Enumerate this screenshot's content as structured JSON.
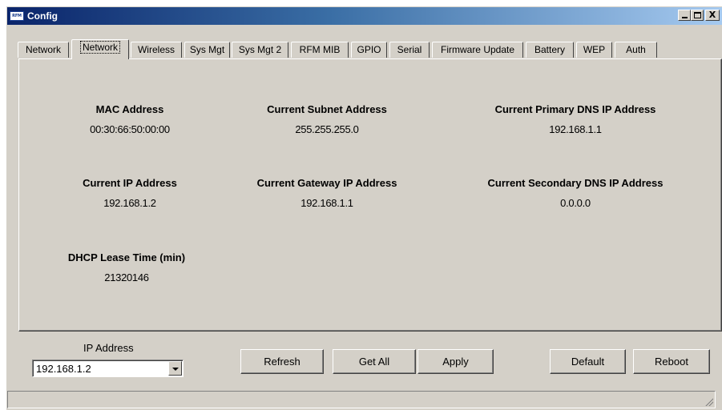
{
  "window": {
    "title": "Config",
    "icon_text": "RFM",
    "close_glyph": "X"
  },
  "tabs": [
    {
      "label": "Network",
      "active": false
    },
    {
      "label": "Network",
      "active": true
    },
    {
      "label": "Wireless",
      "active": false
    },
    {
      "label": "Sys Mgt",
      "active": false
    },
    {
      "label": "Sys Mgt 2",
      "active": false
    },
    {
      "label": "RFM MIB",
      "active": false
    },
    {
      "label": "GPIO",
      "active": false
    },
    {
      "label": "Serial",
      "active": false
    },
    {
      "label": "Firmware Update",
      "active": false
    },
    {
      "label": "Battery",
      "active": false
    },
    {
      "label": "WEP",
      "active": false
    },
    {
      "label": "Auth",
      "active": false
    }
  ],
  "fields": {
    "mac": {
      "label": "MAC Address",
      "value": "00:30:66:50:00:00"
    },
    "subnet": {
      "label": "Current Subnet Address",
      "value": "255.255.255.0"
    },
    "primary_dns": {
      "label": "Current Primary DNS IP Address",
      "value": "192.168.1.1"
    },
    "ip": {
      "label": "Current IP Address",
      "value": "192.168.1.2"
    },
    "gateway": {
      "label": "Current Gateway IP Address",
      "value": "192.168.1.1"
    },
    "secondary_dns": {
      "label": "Current Secondary DNS IP Address",
      "value": "0.0.0.0"
    },
    "dhcp_lease": {
      "label": "DHCP Lease Time (min)",
      "value": "21320146"
    }
  },
  "ip_selector": {
    "label": "IP Address",
    "selected": "192.168.1.2"
  },
  "buttons": {
    "refresh": "Refresh",
    "get_all": "Get All",
    "apply": "Apply",
    "default": "Default",
    "reboot": "Reboot"
  },
  "status_bar": {
    "text": ""
  },
  "colors": {
    "face": "#d4d0c8",
    "title_start": "#0a246a",
    "title_end": "#a6caf0"
  }
}
